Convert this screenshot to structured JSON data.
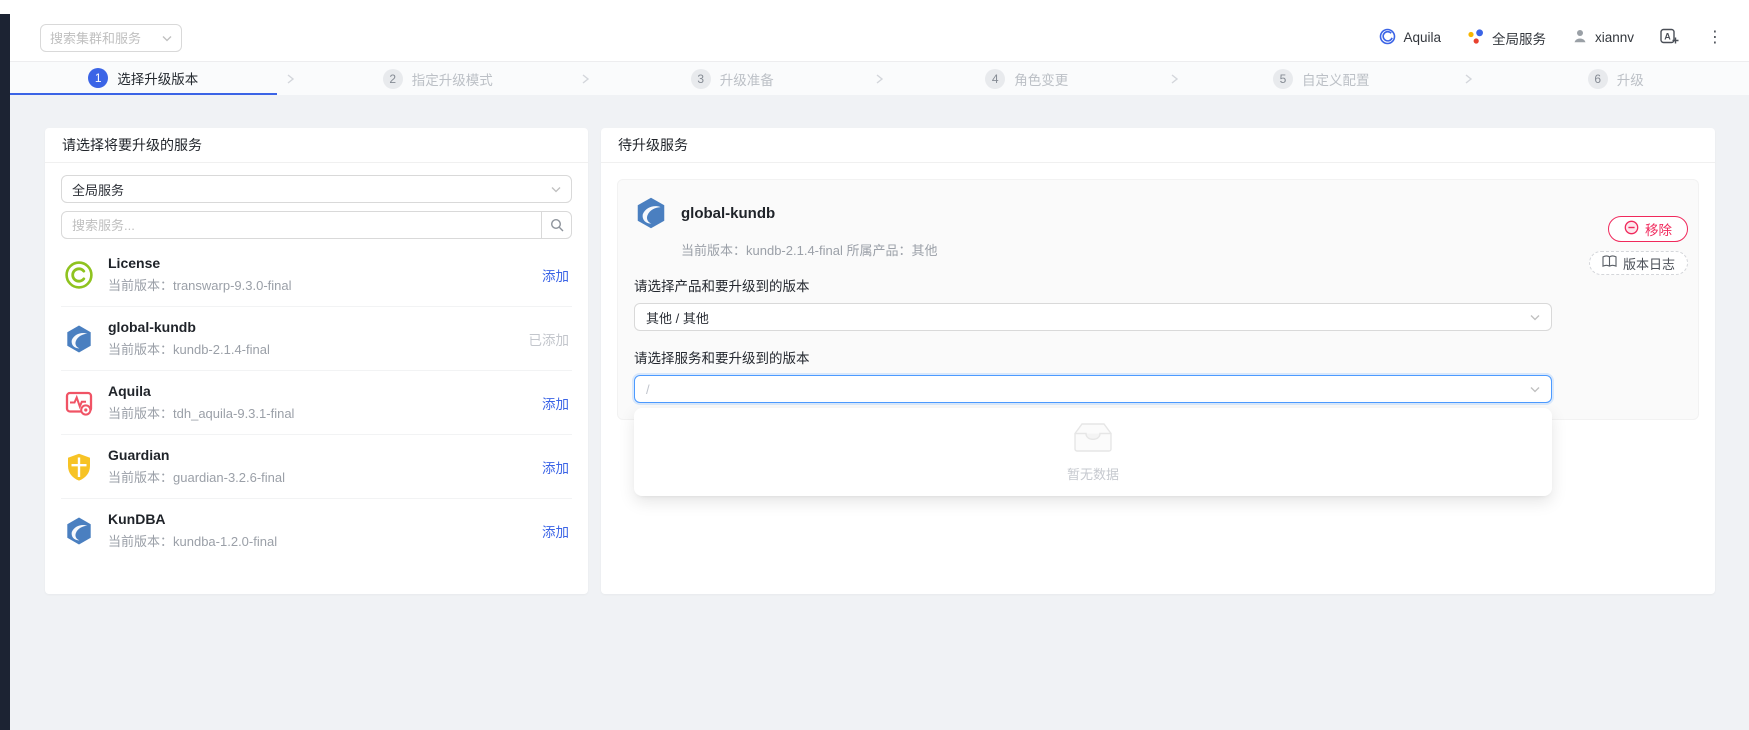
{
  "colors": {
    "accent": "#3b64e6",
    "danger": "#f0295c",
    "rail": "#1c2333",
    "background": "#f0f2f5"
  },
  "topbar": {
    "search_placeholder": "搜索集群和服务",
    "product_name": "Aquila",
    "scope_name": "全局服务",
    "user_name": "xiannv"
  },
  "steps": [
    {
      "num": "1",
      "label": "选择升级版本"
    },
    {
      "num": "2",
      "label": "指定升级模式"
    },
    {
      "num": "3",
      "label": "升级准备"
    },
    {
      "num": "4",
      "label": "角色变更"
    },
    {
      "num": "5",
      "label": "自定义配置"
    },
    {
      "num": "6",
      "label": "升级"
    }
  ],
  "left_panel": {
    "header": "请选择将要升级的服务",
    "scope_select_value": "全局服务",
    "search_placeholder": "搜索服务...",
    "version_prefix": "当前版本：",
    "services": [
      {
        "name": "License",
        "version": "transwarp-9.3.0-final",
        "action": "添加",
        "added": false,
        "icon": "license-icon"
      },
      {
        "name": "global-kundb",
        "version": "kundb-2.1.4-final",
        "action": "已添加",
        "added": true,
        "icon": "kundb-icon"
      },
      {
        "name": "Aquila",
        "version": "tdh_aquila-9.3.1-final",
        "action": "添加",
        "added": false,
        "icon": "aquila-icon"
      },
      {
        "name": "Guardian",
        "version": "guardian-3.2.6-final",
        "action": "添加",
        "added": false,
        "icon": "guardian-icon"
      },
      {
        "name": "KunDBA",
        "version": "kundba-1.2.0-final",
        "action": "添加",
        "added": false,
        "icon": "kundba-icon"
      }
    ]
  },
  "right_panel": {
    "header": "待升级服务",
    "card": {
      "name": "global-kundb",
      "icon": "kundb-icon",
      "version_label": "当前版本：",
      "version": "kundb-2.1.4-final",
      "product_label": "所属产品：",
      "product": "其他",
      "remove_label": "移除",
      "changelog_label": "版本日志",
      "product_select_label": "请选择产品和要升级到的版本",
      "product_select_value": "其他 / 其他",
      "service_select_label": "请选择服务和要升级到的版本",
      "service_select_value": "/",
      "empty_text": "暂无数据"
    }
  }
}
